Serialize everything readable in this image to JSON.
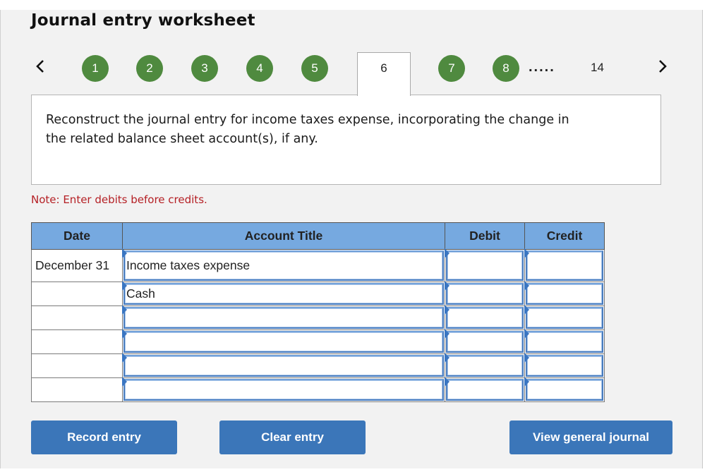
{
  "header": {
    "title": "Journal entry worksheet"
  },
  "navigation": {
    "prev_icon": "chevron-left-icon",
    "next_icon": "chevron-right-icon",
    "steps": [
      {
        "label": "1",
        "state": "completed"
      },
      {
        "label": "2",
        "state": "completed"
      },
      {
        "label": "3",
        "state": "completed"
      },
      {
        "label": "4",
        "state": "completed"
      },
      {
        "label": "5",
        "state": "completed"
      },
      {
        "label": "6",
        "state": "current"
      },
      {
        "label": "7",
        "state": "completed"
      },
      {
        "label": "8",
        "state": "completed"
      }
    ],
    "ellipsis": ".....",
    "last_step": "14",
    "completed_color": "#4f8a3f"
  },
  "question": {
    "text": "Reconstruct the journal entry for income taxes expense, incorporating the change in the related balance sheet account(s), if any."
  },
  "note": {
    "text": "Note: Enter debits before credits.",
    "color": "#b52025"
  },
  "table": {
    "headers": {
      "date": "Date",
      "account": "Account Title",
      "debit": "Debit",
      "credit": "Credit"
    },
    "header_color": "#76a9e0",
    "rows": [
      {
        "date": "December 31",
        "account": "Income taxes expense",
        "debit": "",
        "credit": ""
      },
      {
        "date": "",
        "account": "Cash",
        "debit": "",
        "credit": ""
      },
      {
        "date": "",
        "account": "",
        "debit": "",
        "credit": ""
      },
      {
        "date": "",
        "account": "",
        "debit": "",
        "credit": ""
      },
      {
        "date": "",
        "account": "",
        "debit": "",
        "credit": ""
      },
      {
        "date": "",
        "account": "",
        "debit": "",
        "credit": ""
      }
    ]
  },
  "buttons": {
    "record": "Record entry",
    "clear": "Clear entry",
    "view": "View general journal",
    "color": "#3b76b9"
  }
}
